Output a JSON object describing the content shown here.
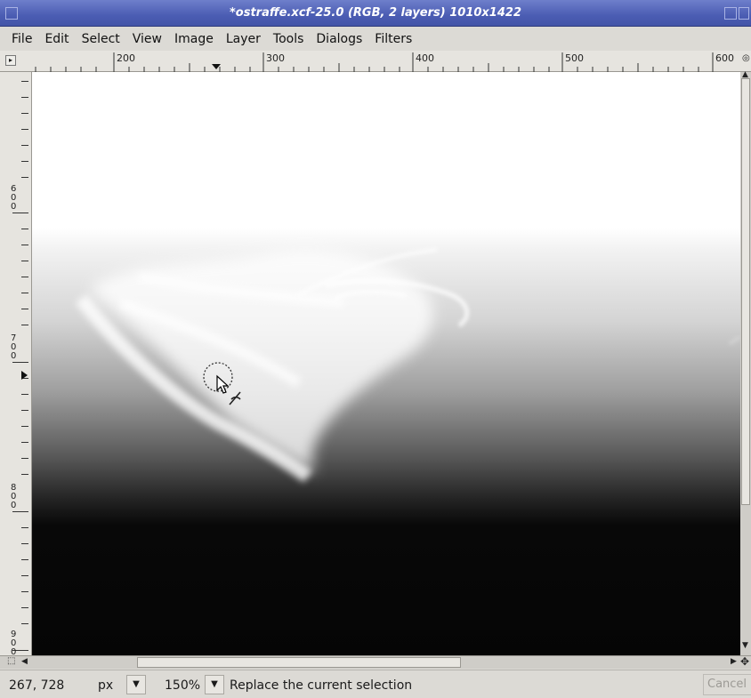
{
  "window": {
    "title": "*ostraffe.xcf-25.0 (RGB, 2 layers) 1010x1422"
  },
  "menu": [
    "File",
    "Edit",
    "Select",
    "View",
    "Image",
    "Layer",
    "Tools",
    "Dialogs",
    "Filters"
  ],
  "rulers": {
    "horizontal_labels": [
      "200",
      "300",
      "400",
      "500",
      "600"
    ],
    "vertical_labels": [
      "600",
      "700",
      "800",
      "900"
    ]
  },
  "statusbar": {
    "coordinates": "267, 728",
    "unit": "px",
    "zoom": "150%",
    "message": "Replace the current selection",
    "cancel_label": "Cancel"
  },
  "icons": {
    "ruler_corner": "triangle-right-icon",
    "scroll_left": "arrow-left-icon",
    "scroll_right": "arrow-right-icon",
    "scroll_up": "arrow-up-icon",
    "scroll_down": "arrow-down-icon",
    "navigate": "navigate-icon",
    "quickmask": "quickmask-icon",
    "cursor": "free-select-cursor-icon"
  },
  "colors": {
    "titlebar": "#4b5db3",
    "window_bg": "#dcdad5"
  }
}
